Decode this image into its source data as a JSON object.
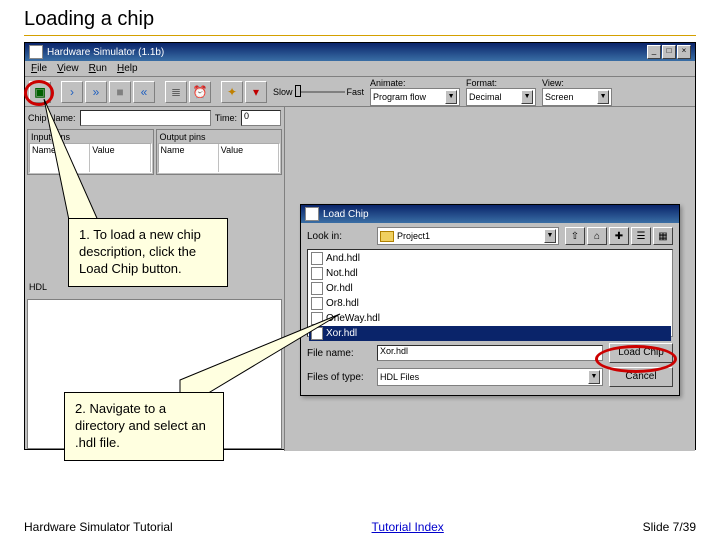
{
  "slide": {
    "title": "Loading a chip",
    "footer_left": "Hardware Simulator Tutorial",
    "footer_center": "Tutorial Index",
    "footer_right": "Slide 7/39"
  },
  "sim": {
    "title": "Hardware Simulator (1.1b)",
    "menu": [
      "File",
      "View",
      "Run",
      "Help"
    ],
    "slider": {
      "slow": "Slow",
      "fast": "Fast"
    },
    "combos": {
      "animate_label": "Animate:",
      "animate_value": "Program flow",
      "format_label": "Format:",
      "format_value": "Decimal",
      "view_label": "View:",
      "view_value": "Screen"
    },
    "chip_name_label": "Chip Name:",
    "time_label": "Time:",
    "time_value": "0",
    "input_pins_label": "Input pins",
    "output_pins_label": "Output pins",
    "col_name": "Name",
    "col_value": "Value",
    "hdl_label": "HDL"
  },
  "dialog": {
    "title": "Load Chip",
    "lookin_label": "Look in:",
    "lookin_value": "Project1",
    "files": [
      "And.hdl",
      "Not.hdl",
      "Or.hdl",
      "Or8.hdl",
      "OneWay.hdl",
      "Xor.hdl"
    ],
    "selected_file": "Xor.hdl",
    "filename_label": "File name:",
    "filename_value": "Xor.hdl",
    "filetype_label": "Files of type:",
    "filetype_value": "HDL Files",
    "load_btn": "Load Chip",
    "cancel_btn": "Cancel"
  },
  "callouts": {
    "c1": "1. To load a new chip description, click the Load Chip button.",
    "c2": "2. Navigate to a directory and select an .hdl file."
  }
}
